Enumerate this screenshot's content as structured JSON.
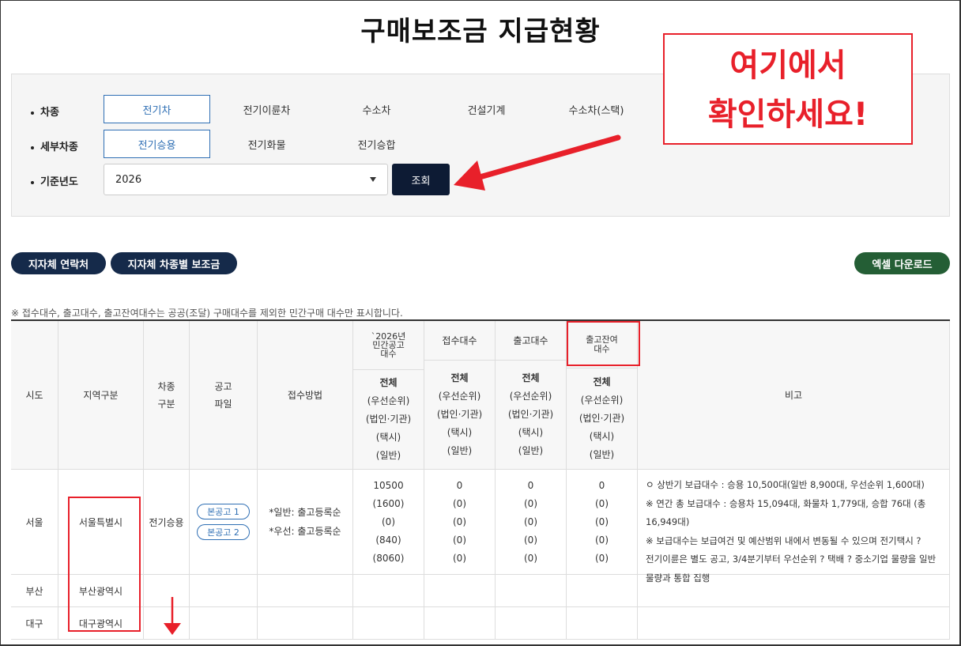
{
  "page": {
    "title": "구매보조금 지급현황"
  },
  "filters": {
    "vehicle_type": {
      "label": "차종",
      "options": [
        "전기차",
        "전기이륜차",
        "수소차",
        "건설기계",
        "수소차(스택)"
      ],
      "active": "전기차"
    },
    "sub_type": {
      "label": "세부차종",
      "options": [
        "전기승용",
        "전기화물",
        "전기승합"
      ],
      "active": "전기승용"
    },
    "base_year": {
      "label": "기준년도",
      "value": "2026"
    },
    "search_button": "조회"
  },
  "actions": {
    "local_contacts": "지자체 연락처",
    "local_subsidy_by_type": "지자체 차종별 보조금",
    "excel_download": "엑셀 다운로드"
  },
  "note": "※ 접수대수, 출고대수, 출고잔여대수는 공공(조달) 구매대수를 제외한 민간구매 대수만 표시합니다.",
  "table": {
    "headers": {
      "region": "시도",
      "area": "지역구분",
      "vehicle_kind": "차종\n구분",
      "notice_file": "공고\n파일",
      "method": "접수방법",
      "announced": "`2026년\n민간공고\n대수",
      "received": "접수대수",
      "shipped": "출고대수",
      "remaining": "출고잔여\n대수",
      "remarks": "비고"
    },
    "sub_header": [
      "전체",
      "(우선순위)",
      "(법인·기관)",
      "(택시)",
      "(일반)"
    ],
    "rows": [
      {
        "region": "서울",
        "area": "서울특별시",
        "vehicle_kind": "전기승용",
        "notice_files": [
          "본공고 1",
          "본공고 2"
        ],
        "method": [
          "*일반: 출고등록순",
          "*우선: 출고등록순"
        ],
        "announced": [
          "10500",
          "(1600)",
          "(0)",
          "(840)",
          "(8060)"
        ],
        "received": [
          "0",
          "(0)",
          "(0)",
          "(0)",
          "(0)"
        ],
        "shipped": [
          "0",
          "(0)",
          "(0)",
          "(0)",
          "(0)"
        ],
        "remaining": [
          "0",
          "(0)",
          "(0)",
          "(0)",
          "(0)"
        ],
        "remarks": [
          "ㅇ 상반기 보급대수 : 승용 10,500대(일반 8,900대, 우선순위 1,600대)",
          "※ 연간 총 보급대수 : 승용차 15,094대, 화물차 1,779대, 승합 76대 (총 16,949대)",
          "※ 보급대수는 보급여건 및 예산범위 내에서 변동될 수 있으며 전기택시 ?",
          "전기이륜은 별도 공고, 3/4분기부터 우선순위 ? 택배 ? 중소기업 물량을 일반",
          "물량과 통합 집행"
        ]
      },
      {
        "region": "부산",
        "area": "부산광역시"
      },
      {
        "region": "대구",
        "area": "대구광역시"
      }
    ]
  },
  "annotation": {
    "callout_line1": "여기에서",
    "callout_line2": "확인하세요!",
    "color": "#e8202a"
  }
}
